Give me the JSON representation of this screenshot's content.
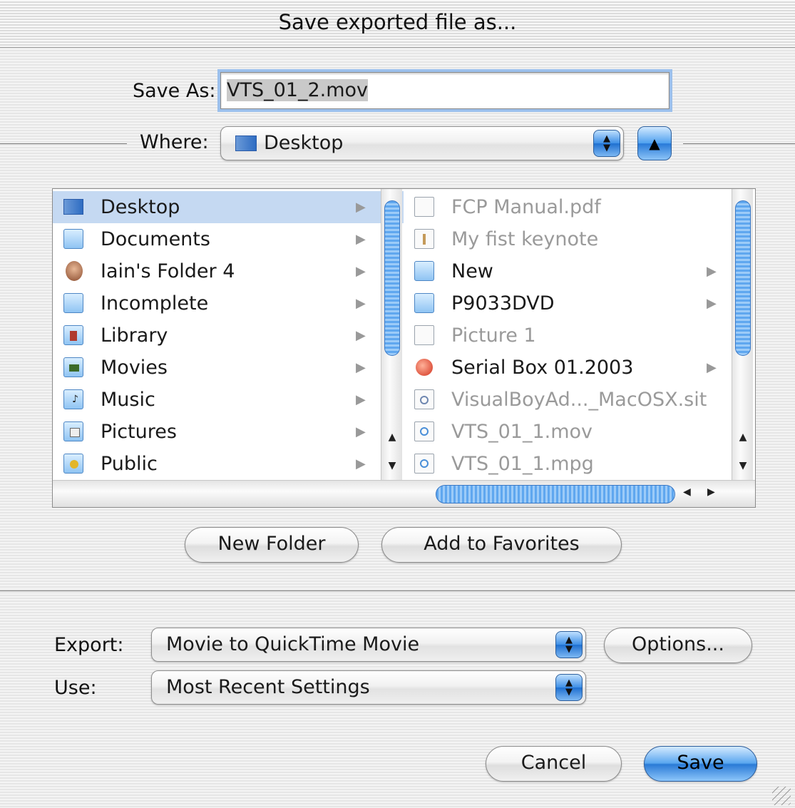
{
  "window": {
    "title": "Save exported file as..."
  },
  "save_as": {
    "label": "Save As:",
    "value": "VTS_01_2.mov"
  },
  "where": {
    "label": "Where:",
    "value": "Desktop",
    "icon": "desktop-icon"
  },
  "browser": {
    "column1": [
      {
        "name": "Desktop",
        "icon": "desktop-icon",
        "selected": true,
        "has_children": true
      },
      {
        "name": "Documents",
        "icon": "documents-folder-icon",
        "has_children": true
      },
      {
        "name": "Iain's Folder 4",
        "icon": "user-avatar-icon",
        "has_children": true
      },
      {
        "name": "Incomplete",
        "icon": "folder-icon",
        "has_children": true
      },
      {
        "name": "Library",
        "icon": "library-folder-icon",
        "has_children": true
      },
      {
        "name": "Movies",
        "icon": "movies-folder-icon",
        "has_children": true
      },
      {
        "name": "Music",
        "icon": "music-folder-icon",
        "has_children": true
      },
      {
        "name": "Pictures",
        "icon": "pictures-folder-icon",
        "has_children": true
      },
      {
        "name": "Public",
        "icon": "public-folder-icon",
        "has_children": true
      }
    ],
    "column2": [
      {
        "name": "FCP Manual.pdf",
        "icon": "pdf-file-icon",
        "dimmed": true
      },
      {
        "name": "My fist keynote",
        "icon": "keynote-file-icon",
        "dimmed": true
      },
      {
        "name": "New",
        "icon": "folder-icon",
        "has_children": true
      },
      {
        "name": "P9033DVD",
        "icon": "folder-icon",
        "has_children": true
      },
      {
        "name": "Picture 1",
        "icon": "pdf-file-icon",
        "dimmed": true
      },
      {
        "name": "Serial Box 01.2003",
        "icon": "serial-box-app-icon",
        "has_children": true
      },
      {
        "name": "VisualBoyAd..._MacOSX.sit",
        "icon": "stuffit-archive-icon",
        "dimmed": true
      },
      {
        "name": "VTS_01_1.mov",
        "icon": "quicktime-movie-icon",
        "dimmed": true
      },
      {
        "name": "VTS_01_1.mpg",
        "icon": "quicktime-movie-icon",
        "dimmed": true
      }
    ]
  },
  "buttons": {
    "new_folder": "New Folder",
    "add_to_favorites": "Add to Favorites",
    "options": "Options...",
    "cancel": "Cancel",
    "save": "Save"
  },
  "export": {
    "label": "Export:",
    "value": "Movie to QuickTime Movie"
  },
  "use": {
    "label": "Use:",
    "value": "Most Recent Settings"
  },
  "colors": {
    "selection": "#c5d9f2",
    "aqua_blue": "#3d8fe6",
    "dimmed_text": "#9a9a9a"
  }
}
